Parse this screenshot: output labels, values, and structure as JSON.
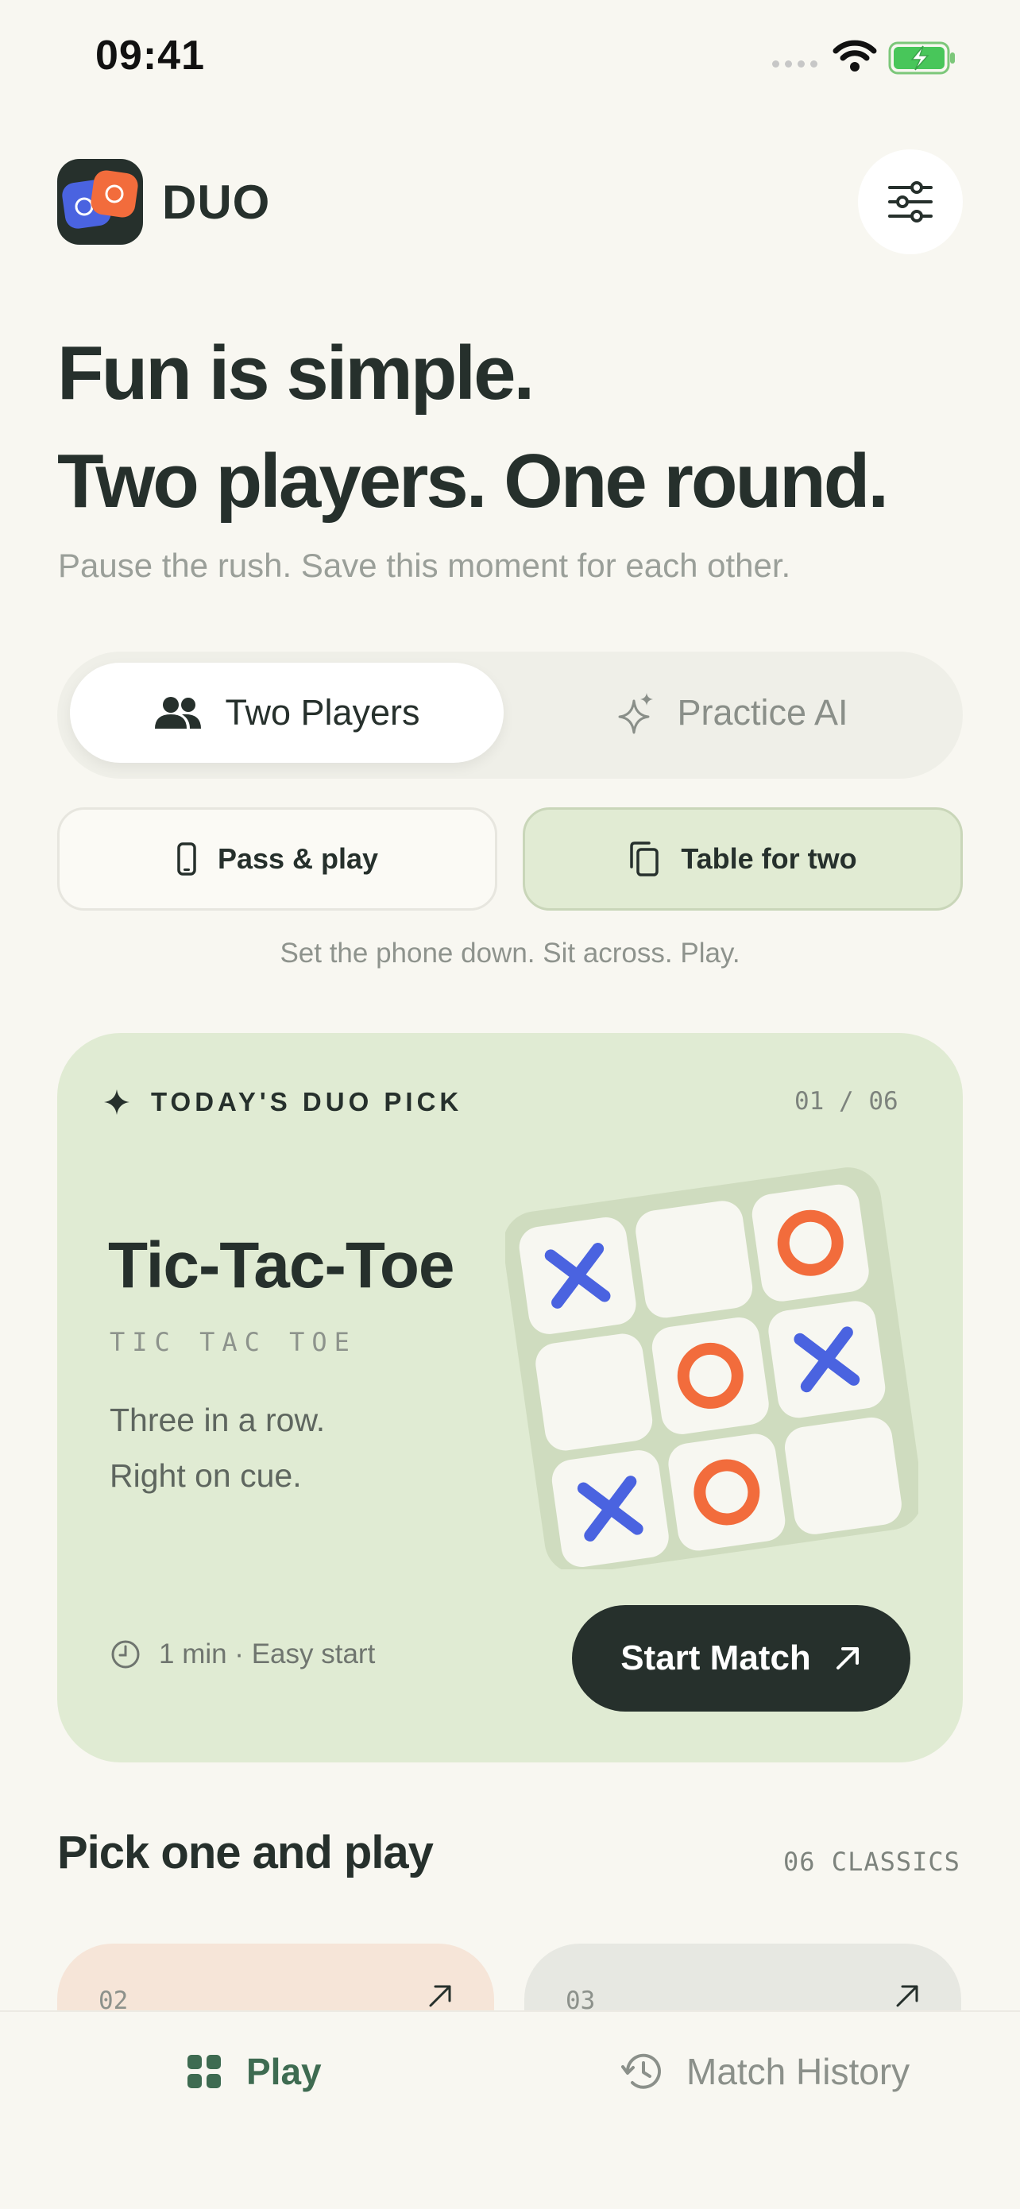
{
  "status_bar": {
    "time": "09:41"
  },
  "header": {
    "brand": "DUO"
  },
  "hero": {
    "line1": "Fun is simple.",
    "line2": "Two players. One round.",
    "subtitle": "Pause the rush. Save this moment for each other."
  },
  "mode_switch": {
    "options": [
      {
        "label": "Two Players",
        "icon": "two-people-icon",
        "selected": true
      },
      {
        "label": "Practice AI",
        "icon": "sparkle-icon",
        "selected": false
      }
    ]
  },
  "play_modes": {
    "pass": {
      "label": "Pass & play",
      "icon": "phone-icon",
      "selected": false
    },
    "table": {
      "label": "Table for two",
      "icon": "copy-icon",
      "selected": true
    },
    "hint": "Set the phone down. Sit across. Play."
  },
  "pick": {
    "label": "TODAY'S DUO PICK",
    "counter": "01 / 06",
    "title": "Tic-Tac-Toe",
    "subtitle": "TIC TAC TOE",
    "desc_line1": "Three in a row.",
    "desc_line2": "Right on cue.",
    "meta": "1 min · Easy start",
    "cta": "Start Match",
    "board": [
      "X",
      "",
      "O",
      "",
      "O",
      "X",
      "X",
      "O",
      ""
    ]
  },
  "section": {
    "title": "Pick one and play",
    "count": "06 CLASSICS"
  },
  "games": [
    {
      "num": "02"
    },
    {
      "num": "03"
    }
  ],
  "tabs": [
    {
      "label": "Play",
      "icon": "grid-icon",
      "active": true
    },
    {
      "label": "Match History",
      "icon": "history-icon",
      "active": false
    }
  ],
  "colors": {
    "background": "#f8f7f1",
    "ink": "#26302c",
    "card_green": "#e0ebd3",
    "x_blue": "#4a63e0",
    "o_orange": "#f26c3c",
    "accent_green": "#3e6b51"
  }
}
